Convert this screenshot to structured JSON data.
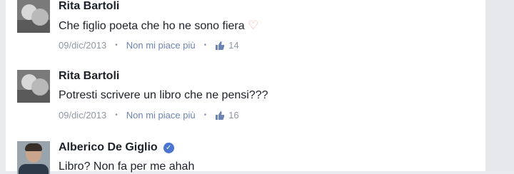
{
  "comments": [
    {
      "author": "Rita Bartoli",
      "text": "Che figlio poeta che ho ne sono fiera",
      "reaction_emoji": "♡",
      "date": "09/dic/2013",
      "action": "Non mi piace più",
      "likes": "14"
    },
    {
      "author": "Rita Bartoli",
      "text": "Potresti scrivere un libro che ne pensi???",
      "date": "09/dic/2013",
      "action": "Non mi piace più",
      "likes": "16"
    },
    {
      "author": "Alberico De Giglio",
      "verified": true,
      "text": "Libro? Non fa per me ahah"
    }
  ],
  "colors": {
    "name": "#1d2129",
    "meta": "#9197a3",
    "link": "#6d84b4",
    "verified": "#4a76d1"
  }
}
